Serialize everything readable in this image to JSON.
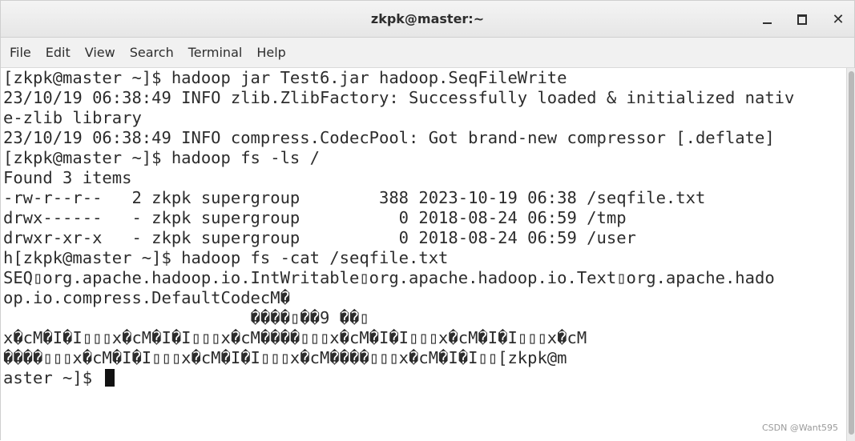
{
  "window": {
    "title": "zkpk@master:~",
    "controls": {
      "minimize": "minimize",
      "maximize": "maximize",
      "close": "close"
    }
  },
  "menu": [
    "File",
    "Edit",
    "View",
    "Search",
    "Terminal",
    "Help"
  ],
  "terminal": {
    "lines": [
      "[zkpk@master ~]$ hadoop jar Test6.jar hadoop.SeqFileWrite",
      "23/10/19 06:38:49 INFO zlib.ZlibFactory: Successfully loaded & initialized nativ",
      "e-zlib library",
      "23/10/19 06:38:49 INFO compress.CodecPool: Got brand-new compressor [.deflate]",
      "[zkpk@master ~]$ hadoop fs -ls /",
      "Found 3 items",
      "-rw-r--r--   2 zkpk supergroup        388 2023-10-19 06:38 /seqfile.txt",
      "drwx------   - zkpk supergroup          0 2018-08-24 06:59 /tmp",
      "drwxr-xr-x   - zkpk supergroup          0 2018-08-24 06:59 /user",
      "h[zkpk@master ~]$ hadoop fs -cat /seqfile.txt",
      "SEQ▯org.apache.hadoop.io.IntWritable▯org.apache.hadoop.io.Text▯org.apache.hado",
      "op.io.compress.DefaultCodecM�",
      "                         ����▯��9 ��▯",
      "x�cM�I�I▯▯▯x�cM�I�I▯▯▯x�cM����▯▯▯x�cM�I�I▯▯▯x�cM�I�I▯▯▯x�cM",
      "����▯▯▯x�cM�I�I▯▯▯x�cM�I�I▯▯▯x�cM����▯▯▯x�cM�I�I▯▯[zkpk@m",
      "aster ~]$ "
    ]
  },
  "watermark": "CSDN @Want595"
}
